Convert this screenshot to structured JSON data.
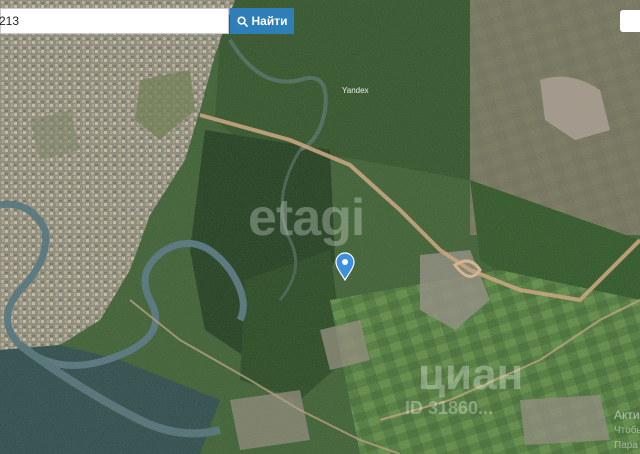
{
  "search": {
    "value": "213",
    "button_label": "Найти"
  },
  "map": {
    "attribution": "Yandex",
    "marker_icon": "location-pin-icon",
    "marker_color": "#3d8fe0"
  },
  "watermarks": {
    "etagi": "etagi",
    "cian": "циан",
    "cian_id": "ID 31860...",
    "activation_line1": "Акти",
    "activation_line2": "Чтобы",
    "activation_line3": "Пара"
  },
  "colors": {
    "button": "#2e7fb8",
    "forest": "#2f5a26",
    "river": "#4a6f78",
    "road": "#c9a27a"
  }
}
